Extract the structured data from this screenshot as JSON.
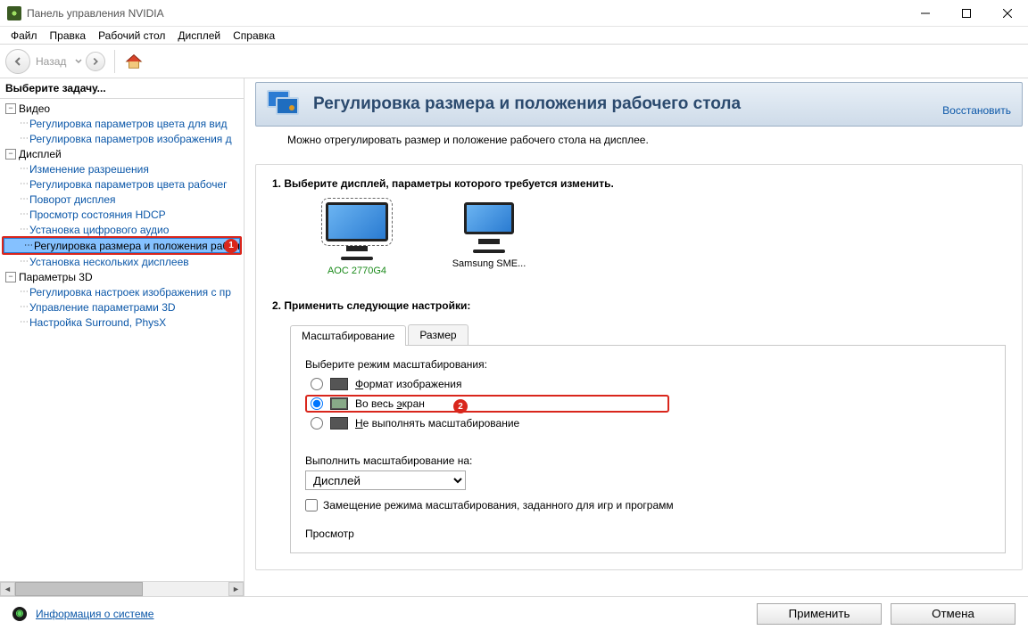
{
  "window": {
    "title": "Панель управления NVIDIA"
  },
  "menu": {
    "file": "Файл",
    "edit": "Правка",
    "desktop": "Рабочий стол",
    "display": "Дисплей",
    "help": "Справка"
  },
  "nav": {
    "back": "Назад"
  },
  "sidebar": {
    "title": "Выберите задачу...",
    "groups": {
      "video": "Видео",
      "display": "Дисплей",
      "params3d": "Параметры 3D"
    },
    "items": {
      "video_color": "Регулировка параметров цвета для вид",
      "video_image": "Регулировка параметров изображения д",
      "change_res": "Изменение разрешения",
      "desktop_color": "Регулировка параметров цвета рабочег",
      "rotate": "Поворот дисплея",
      "hdcp": "Просмотр состояния HDCP",
      "digital_audio": "Установка цифрового аудио",
      "adjust_size": "Регулировка размера и положения рабоч",
      "multi_display": "Установка нескольких дисплеев",
      "image_preview": "Регулировка настроек изображения с пр",
      "manage_3d": "Управление параметрами 3D",
      "surround": "Настройка Surround, PhysX"
    }
  },
  "content": {
    "heading": "Регулировка размера и положения рабочего стола",
    "restore": "Восстановить",
    "description": "Можно отрегулировать размер и положение рабочего стола на дисплее.",
    "step1": "1. Выберите дисплей, параметры которого требуется изменить.",
    "step2": "2. Применить следующие настройки:",
    "displays": [
      {
        "name": "AOC 2770G4"
      },
      {
        "name": "Samsung SME..."
      }
    ],
    "tabs": {
      "scaling": "Масштабирование",
      "size": "Размер"
    },
    "scaling": {
      "choose_mode": "Выберите режим масштабирования:",
      "aspect": "Формат изображения",
      "full": "Во весь экран",
      "none": "Не выполнять масштабирование",
      "perform_on": "Выполнить масштабирование на:",
      "perform_on_value": "Дисплей",
      "override": "Замещение режима масштабирования, заданного для игр и программ",
      "preview": "Просмотр"
    }
  },
  "callouts": {
    "one": "1",
    "two": "2"
  },
  "footer": {
    "sysinfo": "Информация о системе",
    "apply": "Применить",
    "cancel": "Отмена"
  }
}
